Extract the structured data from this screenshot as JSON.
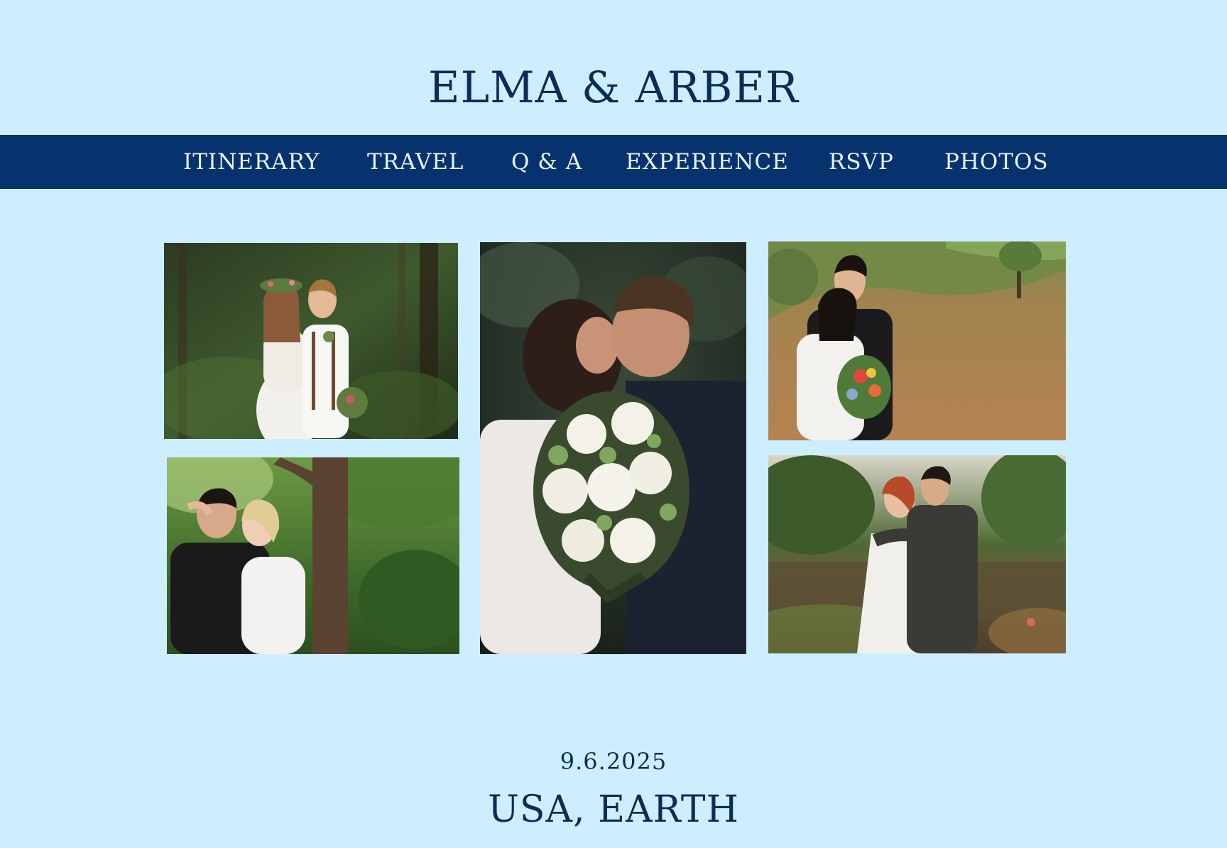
{
  "header": {
    "title": "ELMA & ARBER"
  },
  "nav": {
    "items": [
      {
        "label": "ITINERARY"
      },
      {
        "label": "TRAVEL"
      },
      {
        "label": "Q & A"
      },
      {
        "label": "EXPERIENCE"
      },
      {
        "label": "RSVP"
      },
      {
        "label": "PHOTOS"
      }
    ]
  },
  "gallery": {
    "photos": [
      {
        "subject": "couple-in-forest"
      },
      {
        "subject": "couple-under-tree"
      },
      {
        "subject": "couple-kiss-with-bouquet"
      },
      {
        "subject": "couple-in-field"
      },
      {
        "subject": "couple-by-pond"
      }
    ]
  },
  "event": {
    "date": "9.6.2025",
    "location": "USA, EARTH"
  },
  "colors": {
    "background": "#cdeeff",
    "nav_background": "#06336d",
    "text": "#0b2d55",
    "nav_text": "#e8f2fb"
  }
}
